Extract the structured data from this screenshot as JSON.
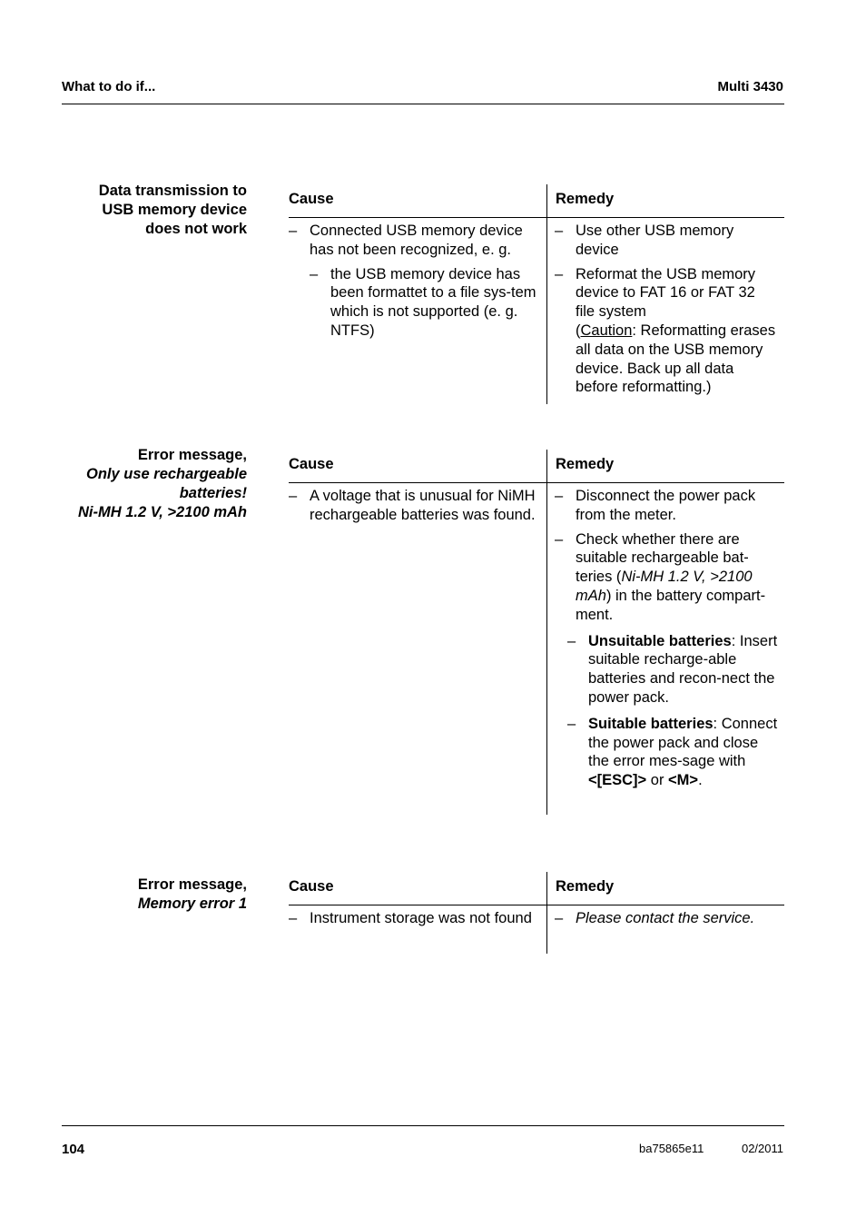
{
  "header": {
    "section": "What to do if...",
    "product": "Multi 3430"
  },
  "sections": [
    {
      "label_lines": [
        "Data transmission to",
        "USB memory device",
        "does not work"
      ],
      "cause_header": "Cause",
      "remedy_header": "Remedy",
      "cause": {
        "main": "Connected USB memory device has not been recognized, e. g.",
        "sub": "the USB memory device has been formattet to a file sys-tem which is not supported (e. g. NTFS)"
      },
      "remedy": {
        "item1": "Use other USB memory device",
        "item2_main": "Reformat the USB memory device to FAT 16 or FAT 32 file system",
        "item2_open": "(",
        "item2_caution": "Caution",
        "item2_rest": ": Reformatting erases all data on the USB memory device. Back up all data before reformatting.)"
      }
    },
    {
      "label_line1": "Error message,",
      "label_italic_lines": [
        "Only use rechargeable",
        "batteries!",
        "Ni-MH 1.2 V, >2100 mAh"
      ],
      "cause_header": "Cause",
      "remedy_header": "Remedy",
      "cause": {
        "main": "A voltage that is unusual for NiMH rechargeable batteries was found."
      },
      "remedy": {
        "item1": "Disconnect the power pack from the meter.",
        "item2_a": "Check whether there are suitable rechargeable bat-teries (",
        "item2_italic": "Ni-MH 1.2 V, >2100 mAh",
        "item2_b": ") in the battery compart-ment.",
        "sub1_bold": "Unsuitable batteries",
        "sub1_rest": ": Insert suitable recharge-able batteries and recon-nect the power pack.",
        "sub2_bold": "Suitable batteries",
        "sub2_rest_a": ": Connect the power pack and close the error mes-sage with ",
        "sub2_key1": "<[ESC]>",
        "sub2_or": " or ",
        "sub2_key2": "<M>",
        "sub2_end": "."
      }
    },
    {
      "label_line1": "Error message,",
      "label_italic": "Memory error 1",
      "cause_header": "Cause",
      "remedy_header": "Remedy",
      "cause": {
        "main": "Instrument storage was not found"
      },
      "remedy": {
        "item1": "Please contact the service."
      }
    }
  ],
  "dash": "–",
  "footer": {
    "page_number": "104",
    "doc_id": "ba75865e11",
    "date": "02/2011"
  }
}
